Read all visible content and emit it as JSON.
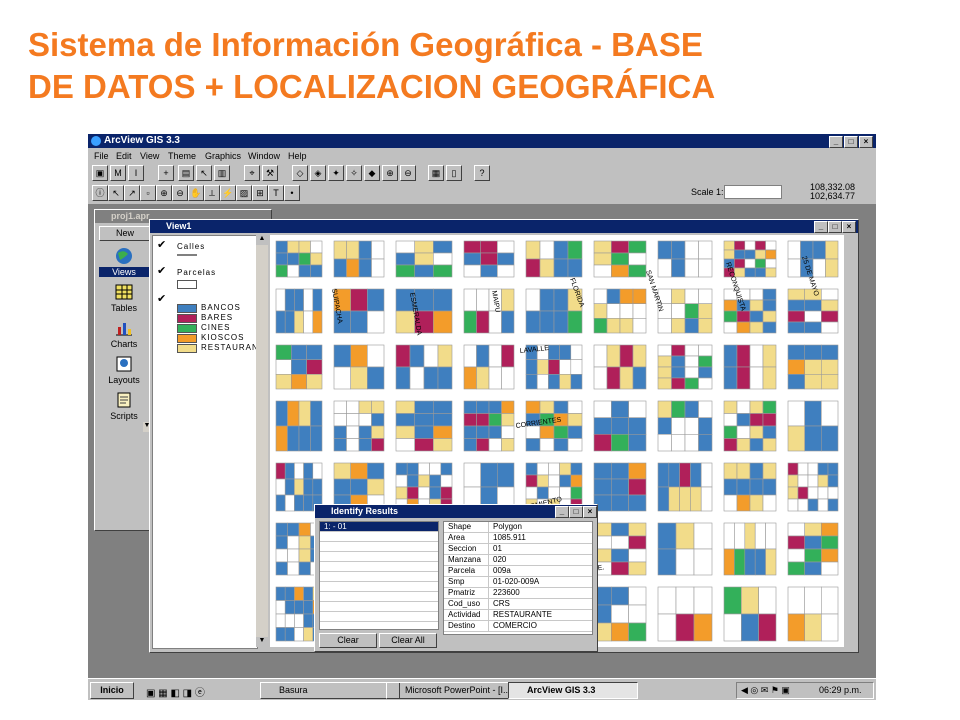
{
  "slide": {
    "title_line1": "Sistema de Información Geográfica - BASE",
    "title_line2": "DE DATOS + LOCALIZACION GEOGRÁFICA"
  },
  "app": {
    "title": "ArcView GIS 3.3",
    "menu": [
      "File",
      "Edit",
      "View",
      "Theme",
      "Graphics",
      "Window",
      "Help"
    ],
    "scale_label": "Scale 1:",
    "coord_x": "108,332.08",
    "coord_y": "102,634.77"
  },
  "project": {
    "title": "proj1.apr",
    "new_label": "New",
    "items": [
      "Views",
      "Tables",
      "Charts",
      "Layouts",
      "Scripts"
    ]
  },
  "view": {
    "title": "View1",
    "themes": {
      "calles": "Calles",
      "parcelas": "Parcelas",
      "legend": [
        {
          "label": "BANCOS",
          "color": "#3f7fbf"
        },
        {
          "label": "BARES",
          "color": "#b0205a"
        },
        {
          "label": "CINES",
          "color": "#33b05a"
        },
        {
          "label": "KIOSCOS",
          "color": "#f39c2a"
        },
        {
          "label": "RESTAURAN",
          "color": "#f2dc8a"
        }
      ]
    },
    "streets": [
      "SUIPACHA",
      "ESMERALDA",
      "MAIPU",
      "FLORIDA",
      "SAN MARTIN",
      "RECONQUISTA",
      "25 DE MAYO",
      "LAVALLE",
      "CORRIENTES",
      "SARMIENTO",
      "PERON, JUAN DOMINGO, TTE."
    ]
  },
  "identify": {
    "title": "Identify Results",
    "selected": "1:  - 01",
    "fields": [
      {
        "k": "Shape",
        "v": "Polygon"
      },
      {
        "k": "Area",
        "v": "1085.911"
      },
      {
        "k": "Seccion",
        "v": "01"
      },
      {
        "k": "Manzana",
        "v": "020"
      },
      {
        "k": "Parcela",
        "v": "009a"
      },
      {
        "k": "Smp",
        "v": "01-020-009A"
      },
      {
        "k": "Pmatriz",
        "v": "223600"
      },
      {
        "k": "Cod_uso",
        "v": "CRS"
      },
      {
        "k": "Actividad",
        "v": "RESTAURANTE"
      },
      {
        "k": "Destino",
        "v": "COMERCIO"
      }
    ],
    "clear_label": "Clear",
    "clear_all_label": "Clear All"
  },
  "taskbar": {
    "start": "Inicio",
    "tasks": [
      "Basura",
      "Microsoft PowerPoint - [I...",
      "ArcView GIS 3.3"
    ],
    "clock": "06:29 p.m."
  }
}
